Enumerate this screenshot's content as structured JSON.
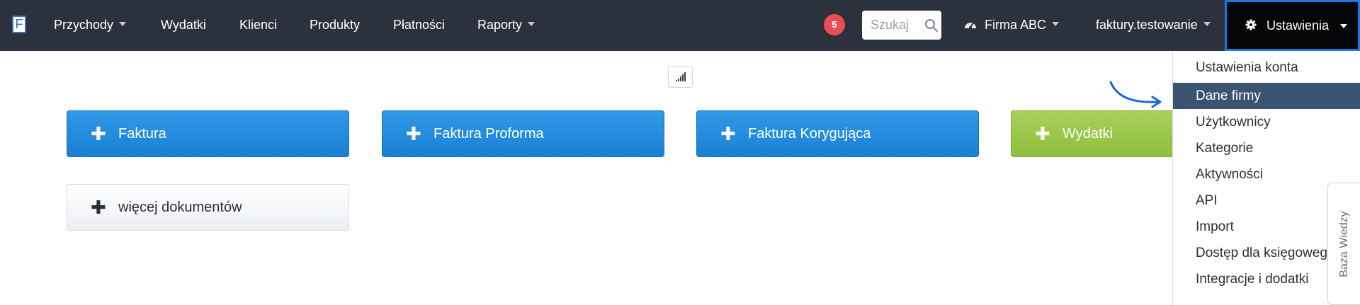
{
  "navbar": {
    "logo": "F",
    "menu": [
      {
        "label": "Przychody",
        "has_caret": true
      },
      {
        "label": "Wydatki",
        "has_caret": false
      },
      {
        "label": "Klienci",
        "has_caret": false
      },
      {
        "label": "Produkty",
        "has_caret": false
      },
      {
        "label": "Płatności",
        "has_caret": false
      },
      {
        "label": "Raporty",
        "has_caret": true
      }
    ],
    "notifications_count": "5",
    "search": {
      "placeholder": "Szukaj",
      "value": "",
      "icon": "search-icon"
    },
    "company": {
      "label": "Firma ABC",
      "icon": "dashboard-icon"
    },
    "account": {
      "label": "faktury.testowanie"
    },
    "settings": {
      "label": "Ustawienia",
      "icon": "gear-icon"
    }
  },
  "signal_icon": "signal-bars-icon",
  "buttons": [
    {
      "label": "Faktura",
      "plus": "✚",
      "style": "blue"
    },
    {
      "label": "Faktura Proforma",
      "plus": "✚",
      "style": "blue"
    },
    {
      "label": "Faktura Korygująca",
      "plus": "✚",
      "style": "blue"
    },
    {
      "label": "Wydatki",
      "plus": "✚",
      "style": "green"
    },
    {
      "label": "więcej dokumentów",
      "plus": "✚",
      "style": "white"
    }
  ],
  "settings_menu": {
    "items": [
      {
        "label": "Ustawienia konta",
        "active": false
      },
      {
        "label": "Dane firmy",
        "active": true
      },
      {
        "label": "Użytkownicy",
        "active": false
      },
      {
        "label": "Kategorie",
        "active": false
      },
      {
        "label": "Aktywności",
        "active": false
      },
      {
        "label": "API",
        "active": false
      },
      {
        "label": "Import",
        "active": false
      },
      {
        "label": "Dostęp dla księgowego",
        "active": false
      },
      {
        "label": "Integracje i dodatki",
        "active": false
      }
    ]
  },
  "knowledge_base_tab": "Baza Wiedzy",
  "colors": {
    "navbar_bg": "#2c323d",
    "button_blue": "#1b7fd5",
    "button_green": "#8fbf3e",
    "active_menu_item": "#3a5370",
    "notification_badge": "#ec4d55",
    "settings_highlight_border": "#1878e8",
    "arrow_annotation": "#1a66d6"
  }
}
